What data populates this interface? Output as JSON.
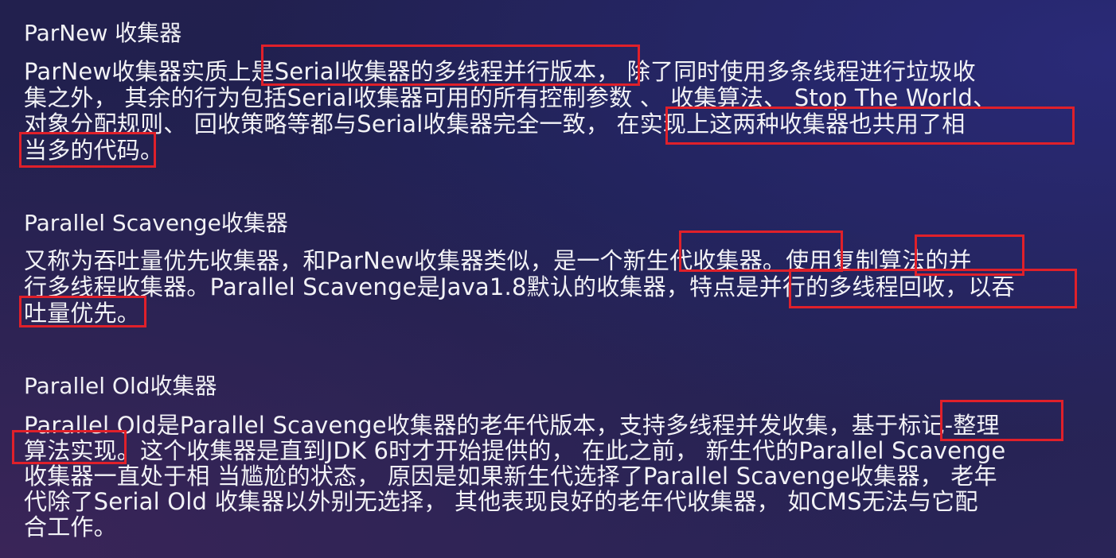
{
  "sections": [
    {
      "heading": "ParNew 收集器",
      "lines": [
        "ParNew收集器实质上是Serial收集器的多线程并行版本， 除了同时使用多条线程进行垃圾收",
        "集之外， 其余的行为包括Serial收集器可用的所有控制参数 、 收集算法、 Stop The World、",
        "对象分配规则、 回收策略等都与Serial收集器完全一致， 在实现上这两种收集器也共用了相",
        "当多的代码。"
      ]
    },
    {
      "heading": "Parallel Scavenge收集器",
      "lines": [
        "又称为吞吐量优先收集器，和ParNew收集器类似，是一个新生代收集器。使用复制算法的并",
        "行多线程收集器。Parallel Scavenge是Java1.8默认的收集器，特点是并行的多线程回收，以吞",
        "吐量优先。"
      ]
    },
    {
      "heading": "Parallel Old收集器",
      "lines": [
        "Parallel Old是Parallel Scavenge收集器的老年代版本，支持多线程并发收集，基于标记-整理",
        "算法实现。这个收集器是直到JDK 6时才开始提供的， 在此之前， 新生代的Parallel Scavenge",
        "收集器一直处于相 当尴尬的状态， 原因是如果新生代选择了Parallel Scavenge收集器， 老年",
        "代除了Serial Old 收集器以外别无选择， 其他表现良好的老年代收集器， 如CMS无法与它配",
        "合工作。"
      ]
    }
  ],
  "highlight_color": "#e0202a"
}
